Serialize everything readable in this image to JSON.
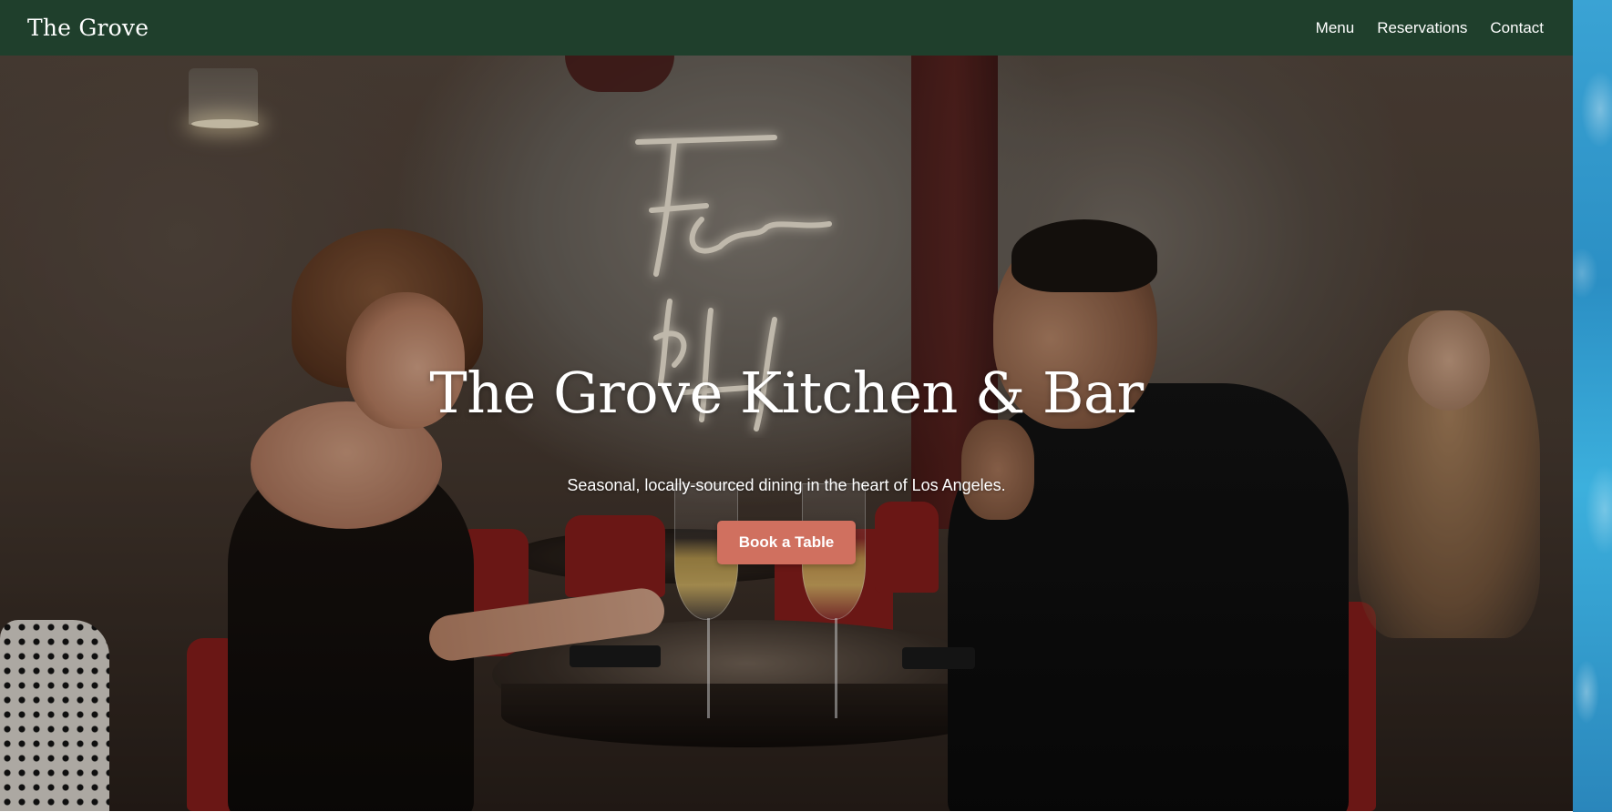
{
  "header": {
    "logo": "The Grove",
    "nav": [
      {
        "label": "Menu"
      },
      {
        "label": "Reservations"
      },
      {
        "label": "Contact"
      }
    ]
  },
  "hero": {
    "title": "The Grove Kitchen & Bar",
    "subtitle": "Seasonal, locally-sourced dining in the heart of Los Angeles.",
    "cta_label": "Book a Table",
    "background_image_description": ""
  },
  "colors": {
    "header_bg": "#1f3f2c",
    "cta_bg": "#d0705f",
    "text": "#ffffff"
  }
}
